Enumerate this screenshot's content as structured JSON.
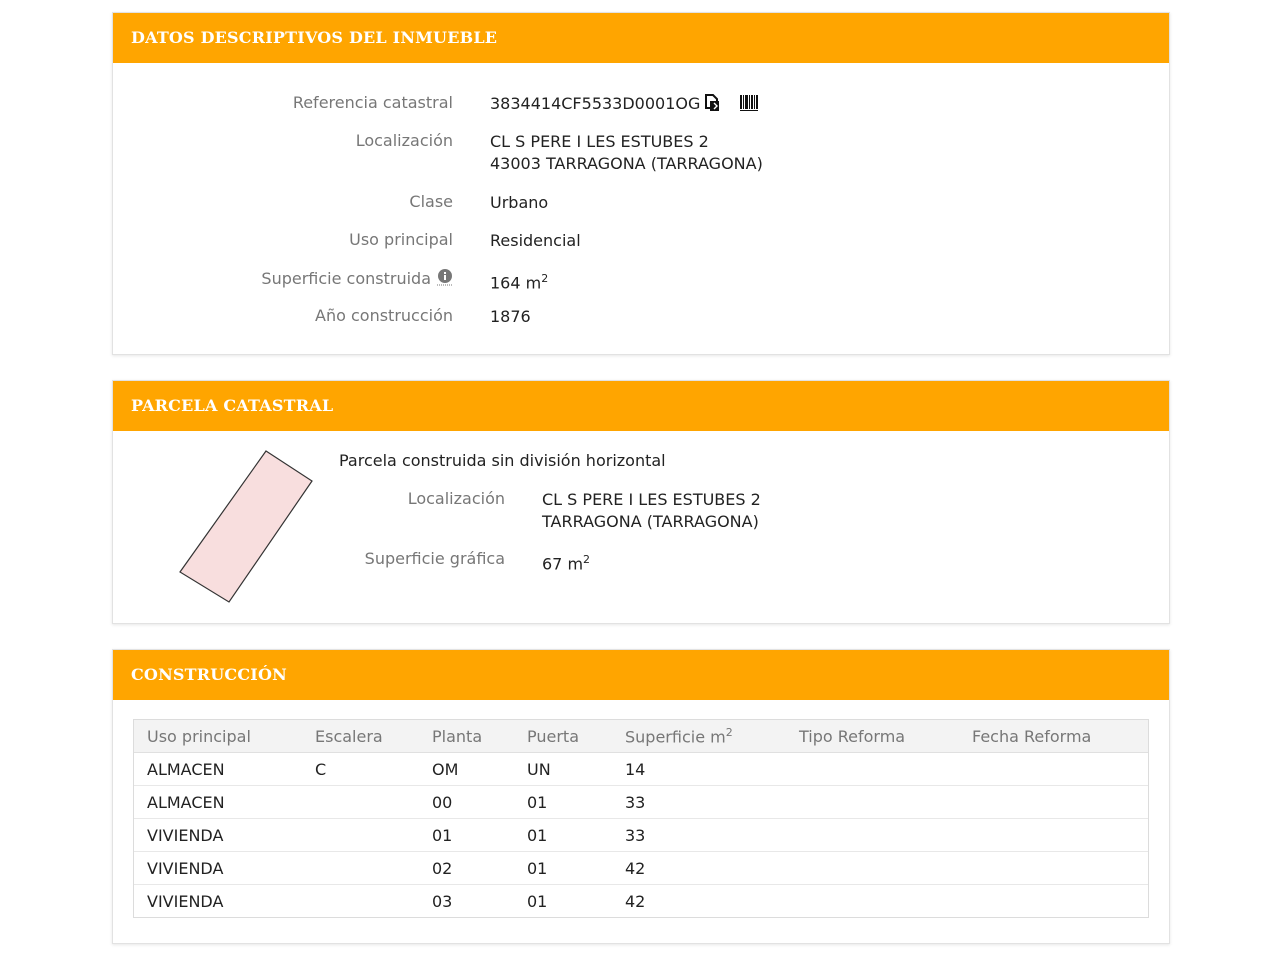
{
  "datos": {
    "header": "DATOS DESCRIPTIVOS DEL INMUEBLE",
    "fields": {
      "referencia_label": "Referencia catastral",
      "referencia_value": "3834414CF5533D0001OG",
      "localizacion_label": "Localización",
      "localizacion_line1": "CL S PERE I LES ESTUBES 2",
      "localizacion_line2": "43003 TARRAGONA (TARRAGONA)",
      "clase_label": "Clase",
      "clase_value": "Urbano",
      "uso_label": "Uso principal",
      "uso_value": "Residencial",
      "superficie_label": "Superficie construida",
      "superficie_value": "164 m",
      "superficie_unit_sup": "2",
      "anio_label": "Año construcción",
      "anio_value": "1876"
    }
  },
  "parcela": {
    "header": "PARCELA CATASTRAL",
    "title": "Parcela construida sin división horizontal",
    "localizacion_label": "Localización",
    "localizacion_line1": "CL S PERE I LES ESTUBES 2",
    "localizacion_line2": "TARRAGONA (TARRAGONA)",
    "superficie_label": "Superficie gráfica",
    "superficie_value": "67 m",
    "superficie_unit_sup": "2"
  },
  "construccion": {
    "header": "CONSTRUCCIÓN",
    "columns": [
      "Uso principal",
      "Escalera",
      "Planta",
      "Puerta",
      "Superficie m",
      "Tipo Reforma",
      "Fecha Reforma"
    ],
    "superficie_col_sup": "2",
    "rows": [
      [
        "ALMACEN",
        "C",
        "OM",
        "UN",
        "14",
        "",
        ""
      ],
      [
        "ALMACEN",
        "",
        "00",
        "01",
        "33",
        "",
        ""
      ],
      [
        "VIVIENDA",
        "",
        "01",
        "01",
        "33",
        "",
        ""
      ],
      [
        "VIVIENDA",
        "",
        "02",
        "01",
        "42",
        "",
        ""
      ],
      [
        "VIVIENDA",
        "",
        "03",
        "01",
        "42",
        "",
        ""
      ]
    ]
  },
  "colors": {
    "accent": "#ffa500",
    "parcel_fill": "#f8dede",
    "label": "#777777"
  },
  "icons": [
    "copy-icon",
    "barcode-icon",
    "info-icon"
  ]
}
